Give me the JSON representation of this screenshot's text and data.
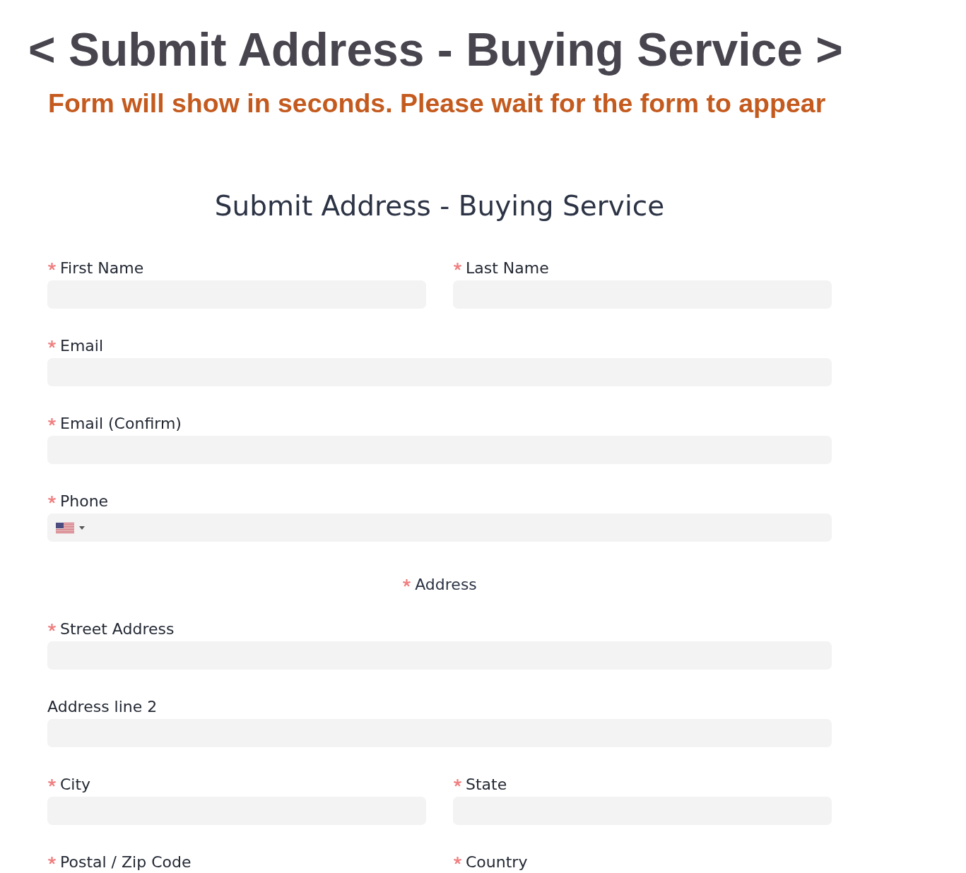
{
  "page": {
    "heading": "< Submit Address - Buying Service >",
    "notice": "Form will show in seconds. Please wait for the form to appear"
  },
  "form": {
    "title": "Submit Address - Buying Service",
    "rows": [
      {
        "fields": [
          {
            "label": "First Name",
            "required": true,
            "input": {
              "kind": "text"
            }
          },
          {
            "label": "Last Name",
            "required": true,
            "input": {
              "kind": "text"
            }
          }
        ]
      },
      {
        "fields": [
          {
            "label": "Email",
            "required": true,
            "input": {
              "kind": "text"
            }
          }
        ]
      },
      {
        "fields": [
          {
            "label": "Email (Confirm)",
            "required": true,
            "input": {
              "kind": "text"
            }
          }
        ]
      },
      {
        "fields": [
          {
            "label": "Phone",
            "required": true,
            "input": {
              "kind": "phone"
            }
          }
        ]
      }
    ],
    "address": {
      "label": "Address",
      "required": true,
      "rows": [
        {
          "fields": [
            {
              "label": "Street Address",
              "required": true,
              "input": {
                "kind": "text"
              }
            }
          ]
        },
        {
          "fields": [
            {
              "label": "Address line 2",
              "required": false,
              "input": {
                "kind": "text"
              }
            }
          ]
        },
        {
          "fields": [
            {
              "label": "City",
              "required": true,
              "input": {
                "kind": "text"
              }
            },
            {
              "label": "State",
              "required": true,
              "input": {
                "kind": "text"
              }
            }
          ]
        },
        {
          "fields": [
            {
              "label": "Postal / Zip Code",
              "required": true
            },
            {
              "label": "Country",
              "required": true
            }
          ]
        }
      ]
    }
  }
}
